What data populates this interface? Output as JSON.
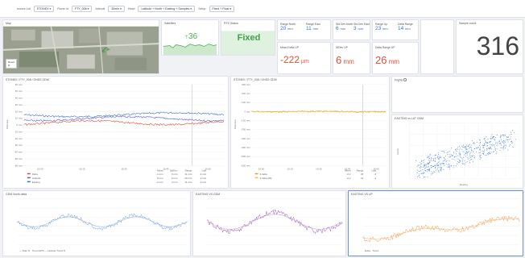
{
  "toolbar": {
    "items": [
      {
        "type": "label",
        "text": "source Lat"
      },
      {
        "type": "chip",
        "text": "STONEX ▾"
      },
      {
        "type": "label",
        "text": "Rover Id"
      },
      {
        "type": "chip",
        "text": "FTY_008 ▾"
      },
      {
        "type": "label",
        "text": "Interval"
      },
      {
        "type": "chip",
        "text": "30min ▾"
      },
      {
        "type": "label",
        "text": "Head"
      },
      {
        "type": "chip",
        "text": "Latitude + North + Easting + Samples ▾"
      },
      {
        "type": "label",
        "text": "Setup"
      },
      {
        "type": "chip",
        "text": "Fixed + Float ▾"
      }
    ]
  },
  "map": {
    "title": "Map",
    "legend_title": "Rover",
    "legend_value": "3"
  },
  "satellites": {
    "title": "Satellites",
    "value": "36"
  },
  "rtk": {
    "title": "RTK Status",
    "value": "Fixed"
  },
  "stats": {
    "range_n": {
      "label": "Range North",
      "value": "20",
      "unit": "mm"
    },
    "range_e": {
      "label": "Range East",
      "value": "11",
      "unit": "mm"
    },
    "stddev_n": {
      "label": "Std Dev North",
      "value": "6",
      "unit": "mm"
    },
    "stddev_e": {
      "label": "Std Dev East",
      "value": "3",
      "unit": "mm"
    },
    "range_up": {
      "label": "Range Up",
      "value": "23",
      "unit": "mm"
    },
    "range_up2": {
      "label": "Delta Range",
      "value": "14",
      "unit": "mm"
    },
    "mean_delta_up": {
      "label": "Mean Delta UP",
      "value": "-222",
      "unit": "µm"
    },
    "stddev_up": {
      "label": "StDev UP",
      "value": "6",
      "unit": "mm"
    },
    "delta_range_up": {
      "label": "Delta Range UP",
      "value": "26",
      "unit": "mm"
    },
    "sample_count": {
      "label": "Sample count",
      "value": "316"
    }
  },
  "chart1": {
    "title": "STONEX / FTY_008 / GNSS GDM",
    "ylabel": "Distance",
    "yticks": [
      "60 mm",
      "50 mm",
      "40 mm",
      "30 mm",
      "20 mm",
      "10 mm",
      "0 mm",
      "-10 mm",
      "-20 mm",
      "-30 mm",
      "-40 mm",
      "-50 mm",
      "-60 mm"
    ],
    "xticks": [
      "15:00",
      "15:15",
      "15:30",
      "15:45",
      "16:00"
    ],
    "legend_headers": [
      "Mean",
      "StdDev",
      "Range",
      "Last"
    ],
    "legend": [
      {
        "name": "Delta",
        "color": "#e04b2b",
        "vals": [
          "-1 mm",
          "3 mm",
          "11 mm",
          "-4 mm"
        ]
      },
      {
        "name": "Latitude",
        "color": "#5a5ad0",
        "vals": [
          "8 mm",
          "6 mm",
          "20 mm",
          "2 mm"
        ]
      },
      {
        "name": "Easting",
        "color": "#3d6fc4",
        "vals": [
          "-2 mm",
          "3 mm",
          "11 mm",
          "-3 mm"
        ]
      }
    ]
  },
  "chart2": {
    "title": "STONEX / FTY_008 / GNSS GDM",
    "ylabel": "Distance",
    "yticks": [
      "300 mm",
      "200 mm",
      "100 mm",
      "0 mm",
      "-100 mm",
      "-200 mm",
      "-300 mm",
      "-400 mm",
      "-500 mm",
      "-600 mm"
    ],
    "xticks": [
      "15:00",
      "15:15",
      "15:30",
      "15:45",
      "16:00"
    ],
    "legend_headers": [
      "Mean",
      "Range",
      "Last"
    ],
    "legend": [
      {
        "name": "Z delta",
        "color": "#e4a21a",
        "vals": [
          "-0.2",
          "26",
          "-3"
        ]
      },
      {
        "name": "Z delta (filt)",
        "color": "#f2c14a",
        "vals": [
          "-0.2",
          "14",
          "-2"
        ]
      }
    ]
  },
  "flights": {
    "title": "Flights"
  },
  "scatter": {
    "title": "EASTING vs LAT GDM",
    "xlabel": "Easting",
    "ylabel": "North"
  },
  "bottom1": {
    "title": "GDM North delta",
    "legend": "— Filter N · Trend GPS   — Latitude Trend N"
  },
  "bottom2": {
    "title": "EASTING VS GDM",
    "legend": ""
  },
  "bottom3": {
    "title": "EASTING VS UP",
    "legend": "Delta · Trend"
  },
  "colors": {
    "accent": "#3a6bd6",
    "green": "#4caf50",
    "red": "#e0523b",
    "purple": "#8a3fb0",
    "orange": "#f0913a"
  }
}
